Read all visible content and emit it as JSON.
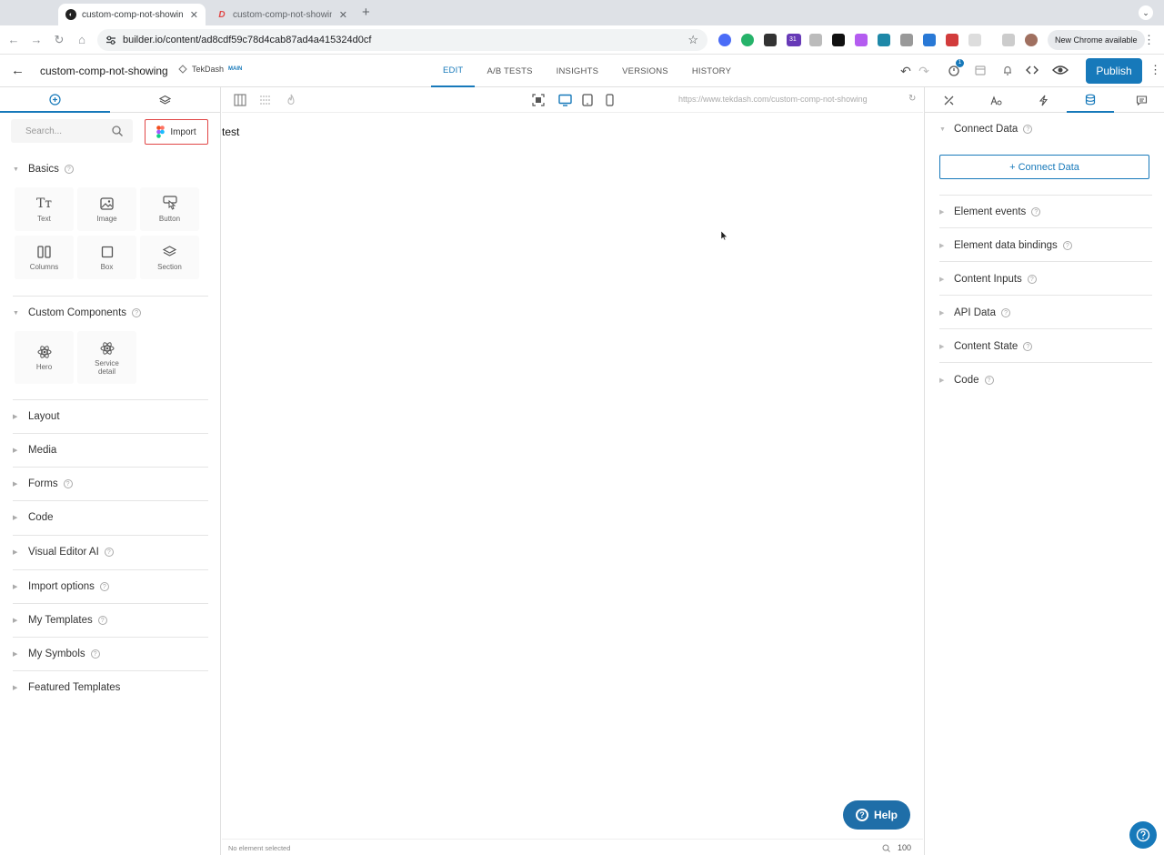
{
  "browser": {
    "tabs": [
      {
        "title": "custom-comp-not-showing |",
        "active": true
      },
      {
        "title": "custom-comp-not-showing - ",
        "active": false
      }
    ],
    "url": "builder.io/content/ad8cdf59c78d4cab87ad4a415324d0cf",
    "new_chrome_label": "New Chrome available",
    "ext_badge": "31"
  },
  "header": {
    "content_title": "custom-comp-not-showing",
    "space_name": "TekDash",
    "branch_badge": "MAIN",
    "tabs": [
      "EDIT",
      "A/B TESTS",
      "INSIGHTS",
      "VERSIONS",
      "HISTORY"
    ],
    "active_tab": "EDIT",
    "notification_count": "1",
    "publish_label": "Publish"
  },
  "left": {
    "search_placeholder": "Search...",
    "import_label": "Import",
    "basics": {
      "title": "Basics",
      "blocks": [
        "Text",
        "Image",
        "Button",
        "Columns",
        "Box",
        "Section"
      ]
    },
    "custom_components": {
      "title": "Custom Components",
      "blocks": [
        "Hero",
        "Service detail"
      ]
    },
    "sections": [
      "Layout",
      "Media",
      "Forms",
      "Code",
      "Visual Editor AI",
      "Import options",
      "My Templates",
      "My Symbols",
      "Featured Templates"
    ]
  },
  "canvas": {
    "preview_url": "https://www.tekdash.com/custom-comp-not-showing",
    "text": "test",
    "help_label": "Help",
    "status": "No element selected",
    "zoom": "100"
  },
  "right": {
    "connect_data_title": "Connect Data",
    "connect_data_button": "+ Connect Data",
    "sections": [
      "Element events",
      "Element data bindings",
      "Content Inputs",
      "API Data",
      "Content State",
      "Code"
    ]
  },
  "colors": {
    "accent": "#1779ba",
    "import_border": "#e14646"
  }
}
